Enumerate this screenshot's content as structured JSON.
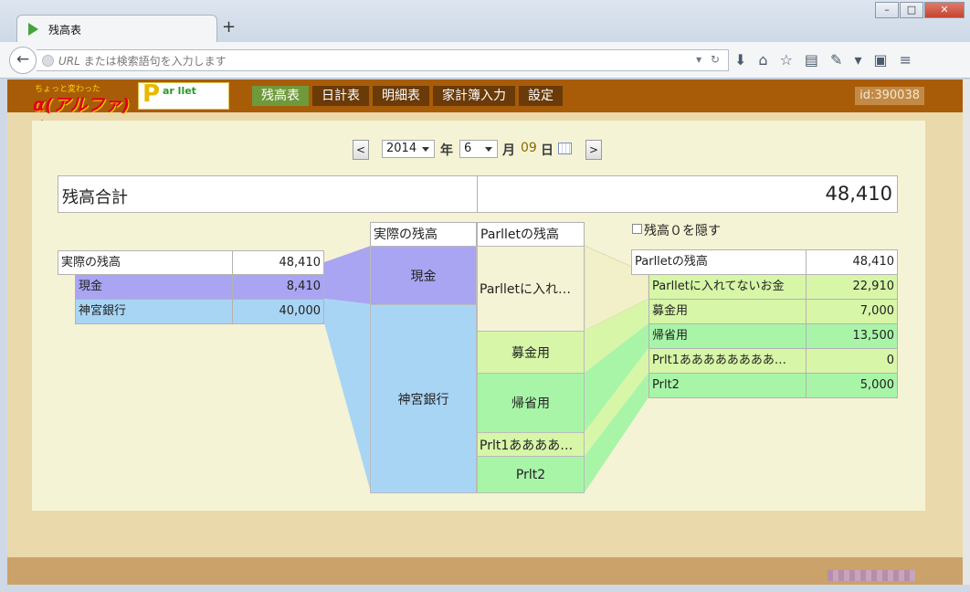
{
  "browser": {
    "tab_title": "残高表",
    "new_tab": "+",
    "url_placeholder_prefix": "URL",
    "url_placeholder_rest": " または検索語句を入力します",
    "win_min": "–",
    "win_max": "□",
    "win_close": "✕"
  },
  "app": {
    "logo_small": "ちょっと変わった",
    "logo_big": "α(アルファ)版",
    "logo2_p": "P",
    "logo2_text": "ar llet",
    "menu": [
      "残高表",
      "日計表",
      "明細表",
      "家計簿入力",
      "設定"
    ],
    "user_id": "id:390038"
  },
  "date": {
    "prev": "<",
    "next": ">",
    "year": "2014",
    "year_label": "年",
    "month": "6",
    "month_label": "月",
    "day": "09",
    "day_label": "日"
  },
  "total": {
    "label": "残高合計",
    "value": "48,410"
  },
  "actual_table": {
    "header_label": "実際の残高",
    "header_value": "48,410",
    "rows": [
      {
        "label": "現金",
        "value": "8,410"
      },
      {
        "label": "神宮銀行",
        "value": "40,000"
      }
    ]
  },
  "center": {
    "col1_header": "実際の残高",
    "col2_header": "Parlletの残高",
    "left_blocks": [
      "現金",
      "神宮銀行"
    ],
    "right_blocks": [
      "Parlletに入れ…",
      "募金用",
      "帰省用",
      "Prlt1ああああ…",
      "Prlt2"
    ]
  },
  "hide_zero": {
    "label": "残高０を隠す",
    "checked": false
  },
  "parllet_table": {
    "header_label": "Parlletの残高",
    "header_value": "48,410",
    "rows": [
      {
        "label": "Parlletに入れてないお金",
        "value": "22,910"
      },
      {
        "label": "募金用",
        "value": "7,000"
      },
      {
        "label": "帰省用",
        "value": "13,500"
      },
      {
        "label": "Prlt1ああああああああ…",
        "value": "0"
      },
      {
        "label": "Prlt2",
        "value": "5,000"
      }
    ]
  },
  "colors": {
    "cash": "#a9a5f2",
    "bank": "#a9d5f5",
    "wallet_unassigned": "#f5f3d5",
    "fund_light": "#d7f6a8",
    "fund_green": "#a8f5a8",
    "menu_active": "#6f9a3c",
    "appbar": "#a85c08"
  }
}
